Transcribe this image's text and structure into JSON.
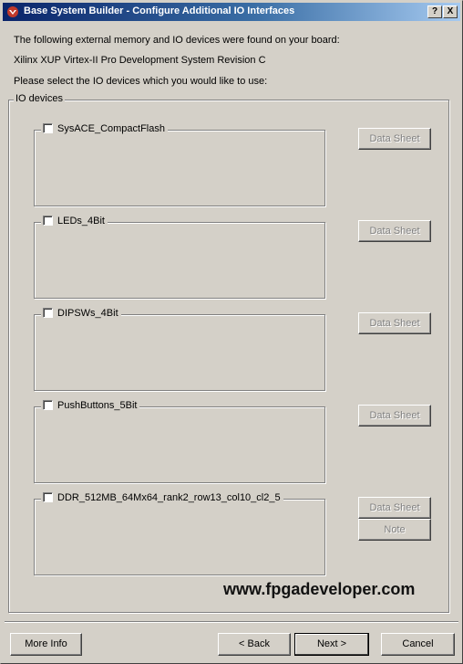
{
  "window": {
    "title": "Base System Builder - Configure Additional IO Interfaces",
    "help_button": "?",
    "close_button": "X"
  },
  "intro": {
    "found_text": "The following external memory and IO devices were found on your board:",
    "board_name": "Xilinx XUP Virtex-II Pro Development System Revision C",
    "select_prompt": "Please select the IO devices which you would like to use:"
  },
  "io_group": {
    "label": "IO devices",
    "devices": [
      {
        "name": "SysACE_CompactFlash",
        "checked": false,
        "datasheet_label": "Data Sheet"
      },
      {
        "name": "LEDs_4Bit",
        "checked": false,
        "datasheet_label": "Data Sheet"
      },
      {
        "name": "DIPSWs_4Bit",
        "checked": false,
        "datasheet_label": "Data Sheet"
      },
      {
        "name": "PushButtons_5Bit",
        "checked": false,
        "datasheet_label": "Data Sheet"
      },
      {
        "name": "DDR_512MB_64Mx64_rank2_row13_col10_cl2_5",
        "checked": false,
        "datasheet_label": "Data Sheet",
        "note_label": "Note"
      }
    ]
  },
  "watermark": "www.fpgadeveloper.com",
  "footer": {
    "more_info": "More Info",
    "back": "< Back",
    "next": "Next >",
    "cancel": "Cancel"
  }
}
